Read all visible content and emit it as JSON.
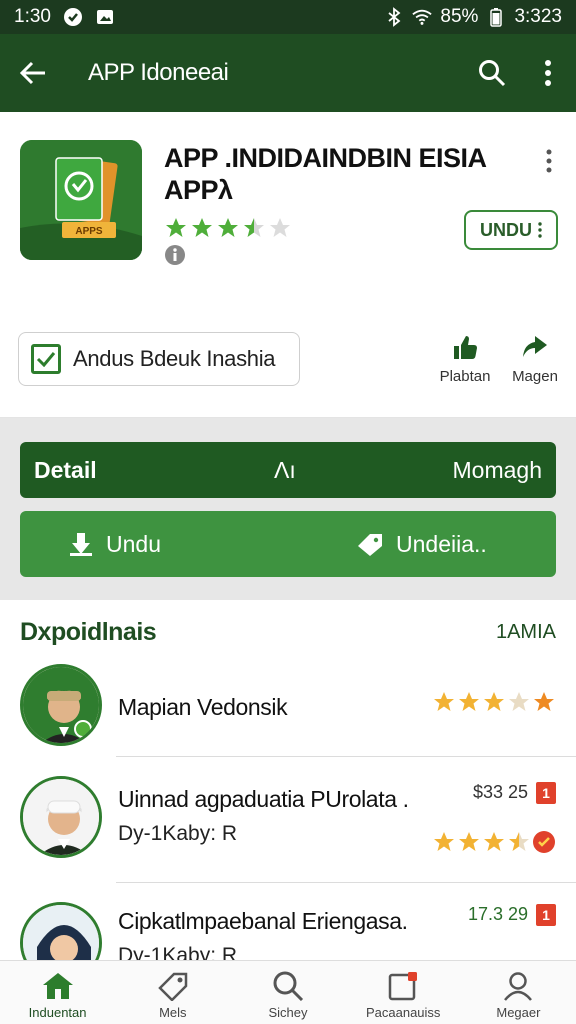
{
  "status_bar": {
    "time": "1:30",
    "battery": "85%",
    "clock_right": "3:323"
  },
  "app_bar": {
    "title": "APP Idoneeai"
  },
  "app": {
    "name": "APP .INDIDAINDBIN EISIA APPλ",
    "rating": 3.5,
    "install_label": "UNDU",
    "badge_text": "Andus Bdeuk Inashia",
    "actions": [
      {
        "label": "Plabtan",
        "icon": "thumb-up-icon"
      },
      {
        "label": "Magen",
        "icon": "share-icon"
      }
    ]
  },
  "detail_bar": {
    "left": "Detail",
    "center": "Λı",
    "right": "Momagh"
  },
  "action_bar": {
    "left": "Undu",
    "right": "Undeiia.."
  },
  "list": {
    "title": "Dxpoidlnais",
    "right_label": "1AMIA",
    "items": [
      {
        "name": "Mapian Vedonsik",
        "rating": 3.5,
        "avatar": "man-cap"
      },
      {
        "name": "Uinnad agpaduatia PUrolata .",
        "sub": "Dy-1Kaby: R",
        "price": "$33 25",
        "tag": "1",
        "rating": 3.5,
        "avatar": "man-white-cap"
      },
      {
        "name": "Cipkatlmpaebanal Eriengasa.",
        "sub": "Dy-1Kaby: R",
        "price": "17.3 29",
        "tag": "1",
        "avatar": "woman-hijab"
      }
    ]
  },
  "bottom_nav": [
    {
      "label": "Induentan",
      "icon": "home-icon"
    },
    {
      "label": "Mels",
      "icon": "tag-icon"
    },
    {
      "label": "Sichey",
      "icon": "search-icon"
    },
    {
      "label": "Pacaanauiss",
      "icon": "notification-icon"
    },
    {
      "label": "Megaer",
      "icon": "profile-icon"
    }
  ],
  "colors": {
    "primary": "#1f4d22",
    "accent": "#3e9340",
    "star": "#f2b233",
    "badge": "#e0412b"
  }
}
